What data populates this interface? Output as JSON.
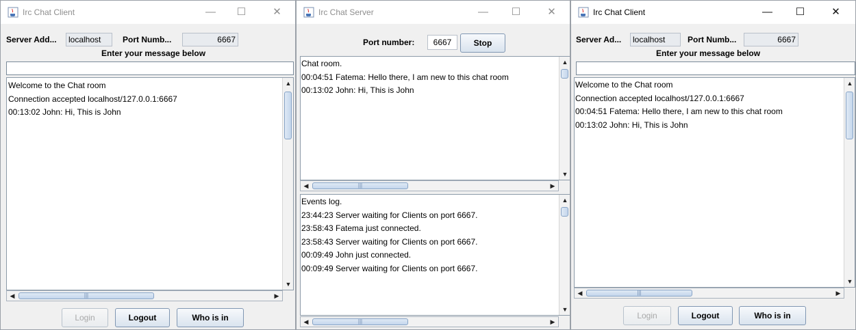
{
  "left_client": {
    "title": "Irc Chat Client",
    "server_label": "Server Add...",
    "server_value": "localhost",
    "port_label": "Port Numb...",
    "port_value": "6667",
    "prompt": "Enter your message below",
    "message_value": "",
    "chat_lines": [
      "Welcome to the Chat room",
      "Connection accepted localhost/127.0.0.1:6667",
      "00:13:02 John: Hi, This is John"
    ],
    "buttons": {
      "login": "Login",
      "logout": "Logout",
      "whoisin": "Who is in"
    }
  },
  "server": {
    "title": "Irc Chat Server",
    "port_label": "Port number:",
    "port_value": "6667",
    "stop_label": "Stop",
    "chat_lines": [
      "Chat room.",
      "00:04:51 Fatema: Hello there, I am new to this chat room",
      "00:13:02 John: Hi, This is John"
    ],
    "event_lines": [
      "Events log.",
      "23:44:23 Server waiting for Clients on port 6667.",
      "23:58:43 Fatema just connected.",
      "23:58:43 Server waiting for Clients on port 6667.",
      "00:09:49 John just connected.",
      "00:09:49 Server waiting for Clients on port 6667."
    ]
  },
  "right_client": {
    "title": "Irc Chat Client",
    "server_label": "Server Ad...",
    "server_value": "localhost",
    "port_label": "Port Numb...",
    "port_value": "6667",
    "prompt": "Enter your message below",
    "message_value": "",
    "chat_lines": [
      "Welcome to the Chat room",
      "Connection accepted localhost/127.0.0.1:6667",
      "00:04:51 Fatema: Hello there, I am new to this chat room",
      "00:13:02 John: Hi, This is John"
    ],
    "buttons": {
      "login": "Login",
      "logout": "Logout",
      "whoisin": "Who is in"
    }
  },
  "window_controls": {
    "minimize": "—",
    "maximize": "☐",
    "close": "✕"
  },
  "icons": {
    "app": "java-cup-icon",
    "scroll_up": "▲",
    "scroll_down": "▼",
    "scroll_left": "◀",
    "scroll_right": "▶",
    "grip": "|||"
  }
}
